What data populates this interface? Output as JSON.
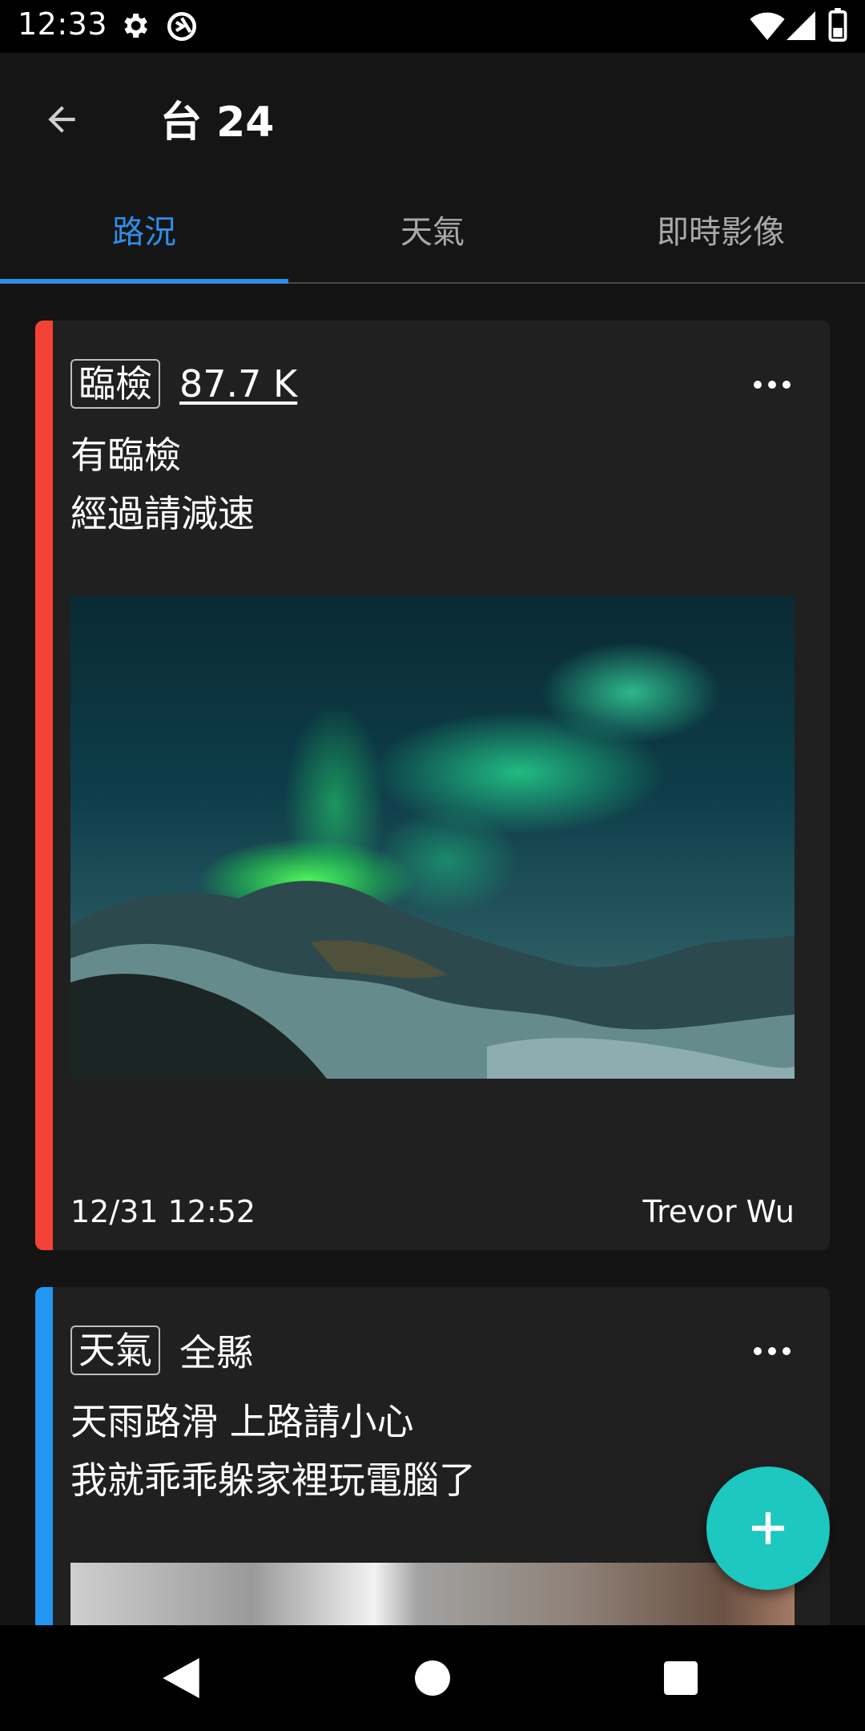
{
  "status_bar": {
    "time": "12:33"
  },
  "app_bar": {
    "title": "台 24"
  },
  "tabs": [
    {
      "label": "路況",
      "active": true
    },
    {
      "label": "天氣",
      "active": false
    },
    {
      "label": "即時影像",
      "active": false
    }
  ],
  "cards": [
    {
      "tag": "臨檢",
      "location": "87.7 K",
      "line1": "有臨檢",
      "line2": "經過請減速",
      "timestamp": "12/31 12:52",
      "author": "Trevor Wu",
      "stripe_color": "#f44336"
    },
    {
      "tag": "天氣",
      "location": "全縣",
      "line1": "天雨路滑 上路請小心",
      "line2": "我就乖乖躲家裡玩電腦了",
      "stripe_color": "#2196f3"
    }
  ],
  "colors": {
    "accent": "#2e8ee6",
    "fab": "#1cc8c0"
  }
}
